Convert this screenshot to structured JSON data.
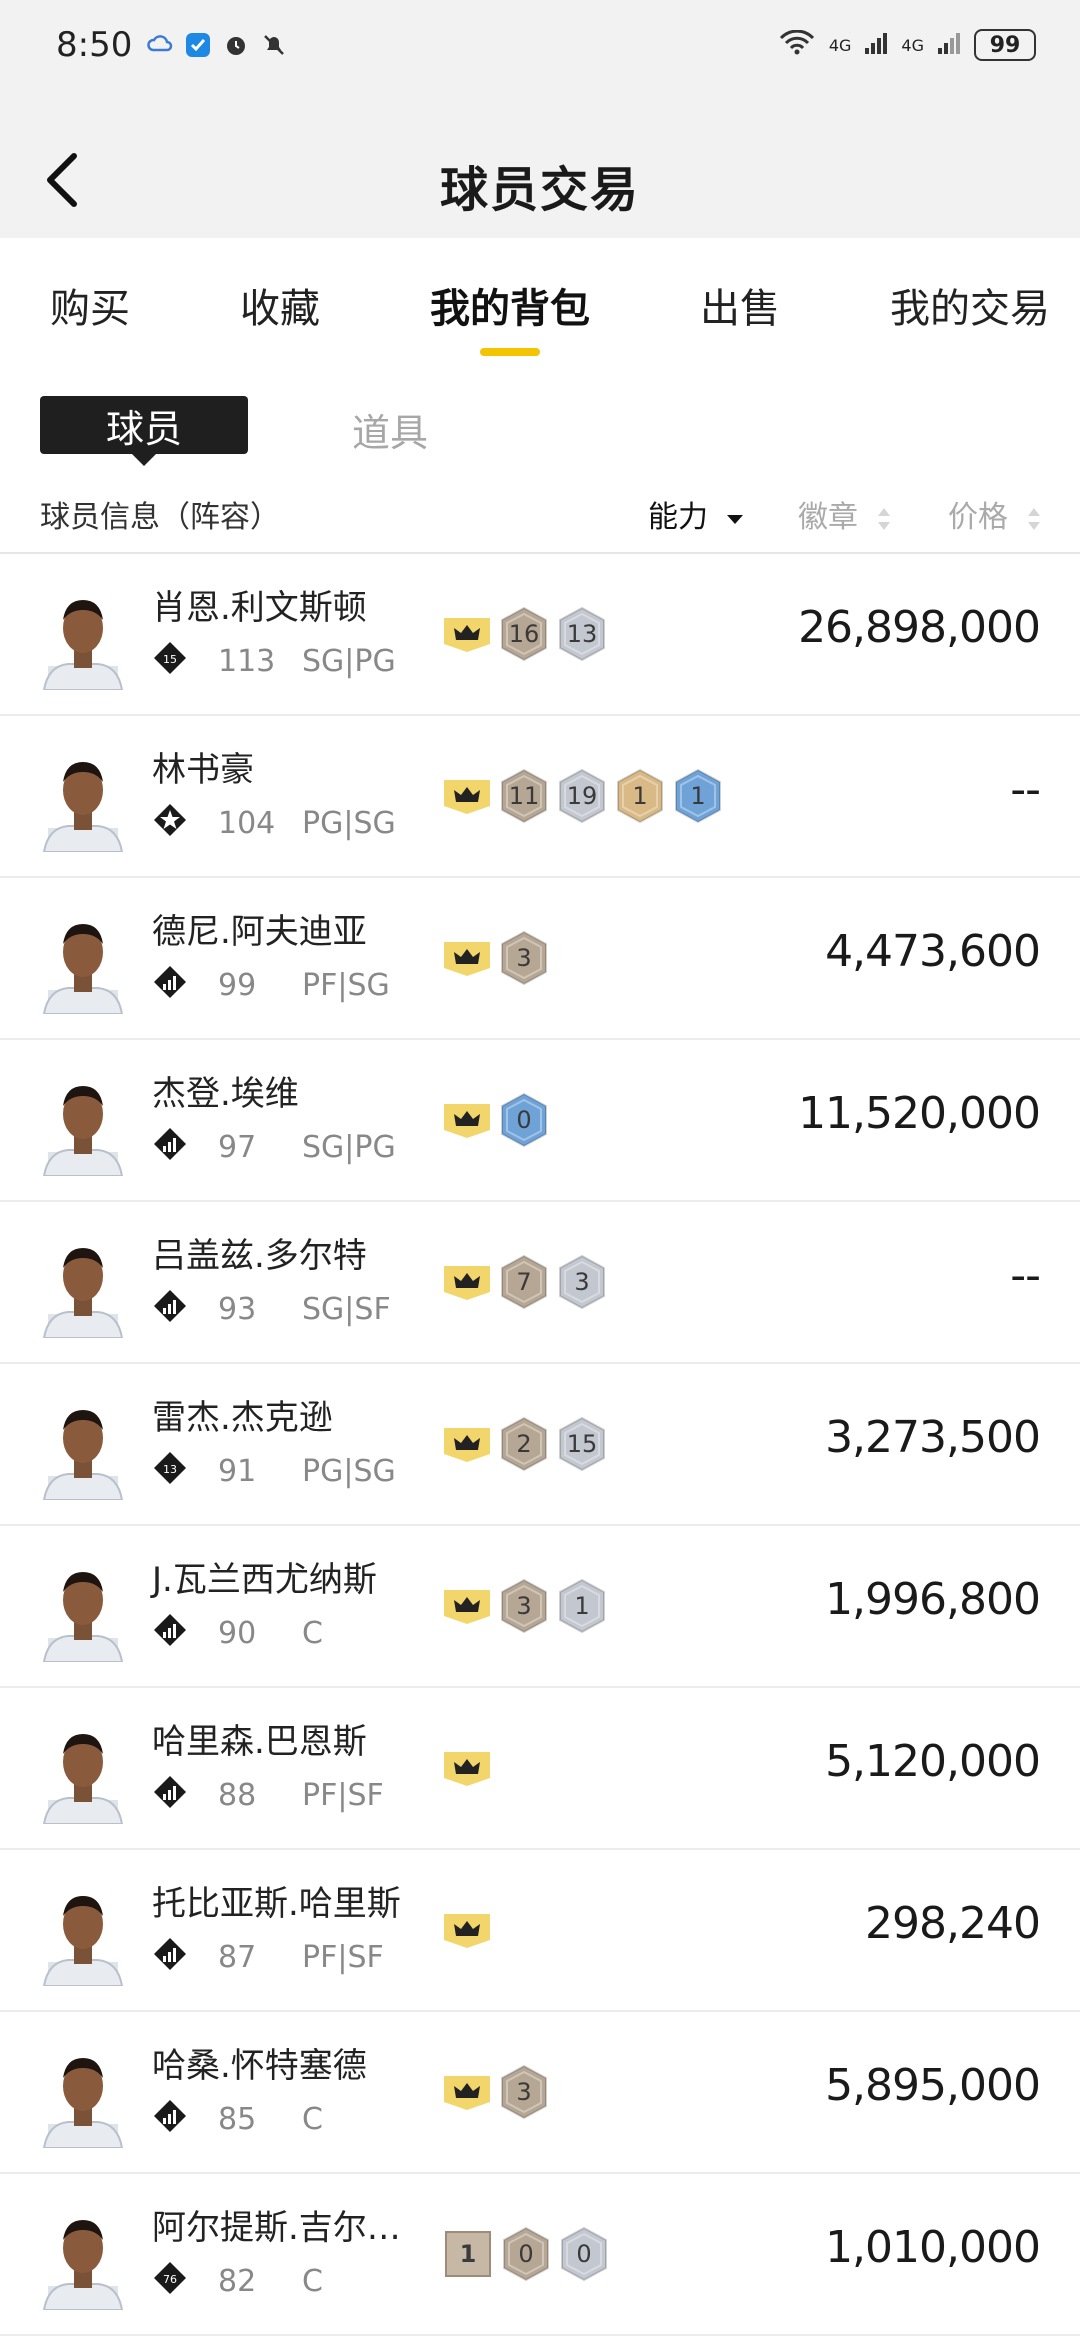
{
  "status_bar": {
    "time": "8:50",
    "battery": "99",
    "network_left": "6",
    "network_a": "4G",
    "network_b": "4G"
  },
  "header": {
    "title": "球员交易"
  },
  "tabs": [
    {
      "label": "购买"
    },
    {
      "label": "收藏"
    },
    {
      "label": "我的背包",
      "active": true
    },
    {
      "label": "出售"
    },
    {
      "label": "我的交易"
    }
  ],
  "subtabs": {
    "players": "球员",
    "props": "道具"
  },
  "columns": {
    "info": "球员信息（阵容）",
    "ability": "能力",
    "badge": "徽章",
    "price": "价格"
  },
  "colors": {
    "accent": "#f5c400",
    "crown_bg": "#f3d66b",
    "hex_brown": "#b6a694",
    "hex_silver": "#c3c7d0",
    "hex_gold": "#d9b985",
    "hex_blue": "#6fa3d8"
  },
  "players": [
    {
      "name": "肖恩.利文斯顿",
      "ability": "113",
      "position": "SG|PG",
      "rank": "15",
      "price": "26,898,000",
      "badges": [
        {
          "type": "crown"
        },
        {
          "type": "brown",
          "value": "16"
        },
        {
          "type": "silver",
          "value": "13"
        }
      ]
    },
    {
      "name": "林书豪",
      "ability": "104",
      "position": "PG|SG",
      "rank": "star",
      "price": "--",
      "badges": [
        {
          "type": "crown"
        },
        {
          "type": "brown",
          "value": "11"
        },
        {
          "type": "silver",
          "value": "19"
        },
        {
          "type": "gold",
          "value": "1"
        },
        {
          "type": "blue",
          "value": "1"
        }
      ]
    },
    {
      "name": "德尼.阿夫迪亚",
      "ability": "99",
      "position": "PF|SG",
      "rank": "bars",
      "price": "4,473,600",
      "badges": [
        {
          "type": "crown"
        },
        {
          "type": "brown",
          "value": "3"
        }
      ]
    },
    {
      "name": "杰登.埃维",
      "ability": "97",
      "position": "SG|PG",
      "rank": "bars",
      "price": "11,520,000",
      "badges": [
        {
          "type": "crown"
        },
        {
          "type": "blue",
          "value": "0"
        }
      ]
    },
    {
      "name": "吕盖兹.多尔特",
      "ability": "93",
      "position": "SG|SF",
      "rank": "bars",
      "price": "--",
      "badges": [
        {
          "type": "crown"
        },
        {
          "type": "brown",
          "value": "7"
        },
        {
          "type": "silver",
          "value": "3"
        }
      ]
    },
    {
      "name": "雷杰.杰克逊",
      "ability": "91",
      "position": "PG|SG",
      "rank": "13",
      "price": "3,273,500",
      "badges": [
        {
          "type": "crown"
        },
        {
          "type": "brown",
          "value": "2"
        },
        {
          "type": "silver",
          "value": "15"
        }
      ]
    },
    {
      "name": "J.瓦兰西尤纳斯",
      "ability": "90",
      "position": "C",
      "rank": "bars",
      "price": "1,996,800",
      "badges": [
        {
          "type": "crown"
        },
        {
          "type": "brown",
          "value": "3"
        },
        {
          "type": "silver",
          "value": "1"
        }
      ]
    },
    {
      "name": "哈里森.巴恩斯",
      "ability": "88",
      "position": "PF|SF",
      "rank": "bars",
      "price": "5,120,000",
      "badges": [
        {
          "type": "crown"
        }
      ]
    },
    {
      "name": "托比亚斯.哈里斯",
      "ability": "87",
      "position": "PF|SF",
      "rank": "bars",
      "price": "298,240",
      "badges": [
        {
          "type": "crown"
        }
      ]
    },
    {
      "name": "哈桑.怀特塞德",
      "ability": "85",
      "position": "C",
      "rank": "bars",
      "price": "5,895,000",
      "badges": [
        {
          "type": "crown"
        },
        {
          "type": "brown",
          "value": "3"
        }
      ]
    },
    {
      "name": "阿尔提斯.吉尔…",
      "ability": "82",
      "position": "C",
      "rank": "76",
      "price": "1,010,000",
      "badges": [
        {
          "type": "level",
          "value": "1"
        },
        {
          "type": "brown",
          "value": "0"
        },
        {
          "type": "silver",
          "value": "0"
        }
      ]
    }
  ]
}
